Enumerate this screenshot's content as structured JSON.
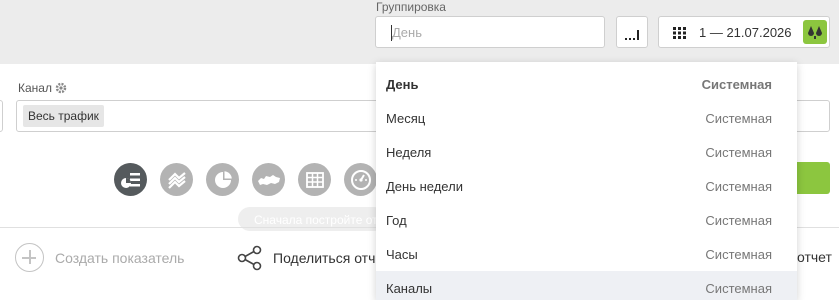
{
  "grouping": {
    "label": "Группировка",
    "placeholder": "День"
  },
  "date_range": {
    "text": "1 — 21.07.2026"
  },
  "channel": {
    "label": "Канал",
    "chip": "Весь трафик"
  },
  "visualization_icons": [
    "summary-chart-icon",
    "area-chart-icon",
    "pie-chart-icon",
    "map-icon",
    "table-icon",
    "gauge-icon"
  ],
  "tooltip": "Сначала постройте отчет",
  "bottom": {
    "create_indicator": "Создать показатель",
    "share": "Поделиться отчетом",
    "report_tail": "отчет"
  },
  "dropdown": {
    "items": [
      {
        "name": "День",
        "type": "Системная"
      },
      {
        "name": "Месяц",
        "type": "Системная"
      },
      {
        "name": "Неделя",
        "type": "Системная"
      },
      {
        "name": "День недели",
        "type": "Системная"
      },
      {
        "name": "Год",
        "type": "Системная"
      },
      {
        "name": "Часы",
        "type": "Системная"
      },
      {
        "name": "Каналы",
        "type": "Системная"
      }
    ]
  },
  "colors": {
    "accent_green": "#8cc63f",
    "icon_gray": "#b3b3b3",
    "icon_active": "#555a5d"
  }
}
